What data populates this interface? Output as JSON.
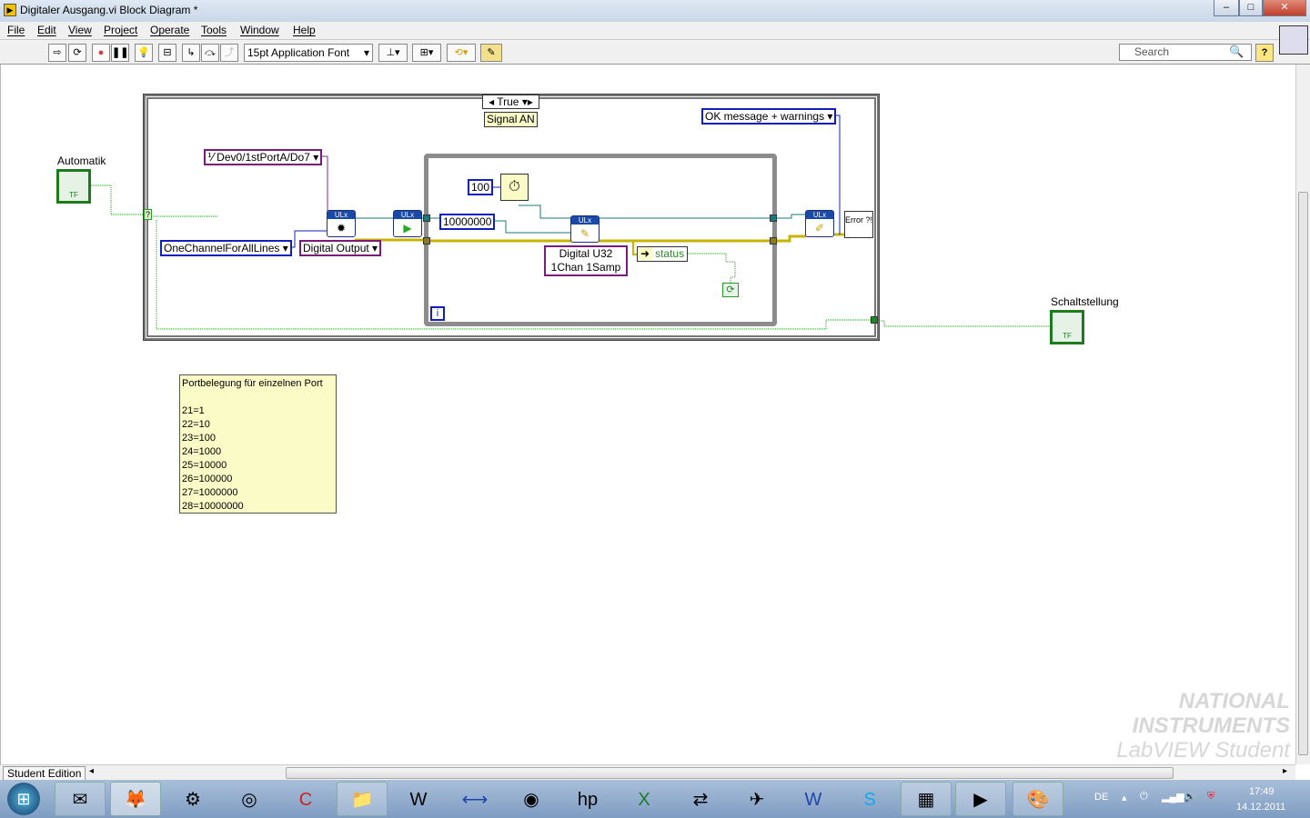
{
  "window": {
    "title": "Digitaler Ausgang.vi Block Diagram *",
    "minimize": "–",
    "maximize": "□",
    "close": "✕"
  },
  "menu": [
    "File",
    "Edit",
    "View",
    "Project",
    "Operate",
    "Tools",
    "Window",
    "Help"
  ],
  "toolbar": {
    "font": "15pt Application Font",
    "search_placeholder": "Search",
    "help": "?"
  },
  "diagram": {
    "case_selector": "True",
    "case_label": "Signal AN",
    "automatik_label": "Automatik",
    "schaltstellung_label": "Schaltstellung",
    "bool_tf": "TF",
    "channel": "Dev0/1stPortA/Do7",
    "lines_mode": "OneChannelForAllLines",
    "task_type": "Digital Output",
    "wait_ms": "100",
    "timeout_const": "10000000",
    "write_type": [
      "Digital U32",
      "1Chan 1Samp"
    ],
    "status": "status",
    "error_mode": "OK message + warnings",
    "error_handler": "Error ?!",
    "ulx": "ULx",
    "iteration": "i",
    "case_terminal": "?"
  },
  "comment": "Portbelegung für einzelnen Port\n\n21=1\n22=10\n23=100\n24=1000\n25=10000\n26=100000\n27=1000000\n28=10000000",
  "status_bar": {
    "edition": "Student Edition"
  },
  "watermark": [
    "NATIONAL",
    "INSTRUMENTS",
    "LabVIEW Student Edition"
  ],
  "taskbar": {
    "apps": [
      "outlook",
      "firefox",
      "app-tool",
      "itunes",
      "ccleaner",
      "explorer",
      "wd",
      "vpn",
      "quicktime",
      "hp",
      "excel",
      "sync",
      "mail",
      "word",
      "skype",
      "calculator",
      "labview",
      "paint"
    ],
    "tray": {
      "lang": "DE",
      "time": "17:49",
      "date": "14.12.2011"
    }
  }
}
